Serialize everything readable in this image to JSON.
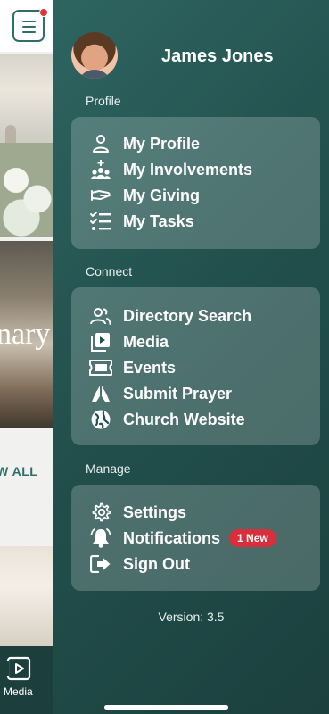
{
  "background": {
    "banner_partial_text": "nary",
    "view_all_partial": "W ALL",
    "bottom_nav": {
      "media_label": "Media"
    }
  },
  "drawer": {
    "user_name": "James Jones",
    "sections": {
      "profile": {
        "label": "Profile",
        "items": [
          {
            "label": "My Profile",
            "icon": "person-icon"
          },
          {
            "label": "My Involvements",
            "icon": "group-icon"
          },
          {
            "label": "My Giving",
            "icon": "hand-giving-icon"
          },
          {
            "label": "My Tasks",
            "icon": "checklist-icon"
          }
        ]
      },
      "connect": {
        "label": "Connect",
        "items": [
          {
            "label": "Directory Search",
            "icon": "people-icon"
          },
          {
            "label": "Media",
            "icon": "play-icon"
          },
          {
            "label": "Events",
            "icon": "ticket-icon"
          },
          {
            "label": "Submit Prayer",
            "icon": "praying-hands-icon"
          },
          {
            "label": "Church Website",
            "icon": "globe-icon"
          }
        ]
      },
      "manage": {
        "label": "Manage",
        "items": [
          {
            "label": "Settings",
            "icon": "gear-icon"
          },
          {
            "label": "Notifications",
            "icon": "bell-icon",
            "badge": "1 New"
          },
          {
            "label": "Sign Out",
            "icon": "sign-out-icon"
          }
        ]
      }
    },
    "version": "Version: 3.5"
  },
  "colors": {
    "drawer_start": "#2e6561",
    "drawer_end": "#1b403e",
    "accent": "#2f6f6b",
    "badge": "#d92e3c",
    "notification_dot": "#e0323c"
  }
}
